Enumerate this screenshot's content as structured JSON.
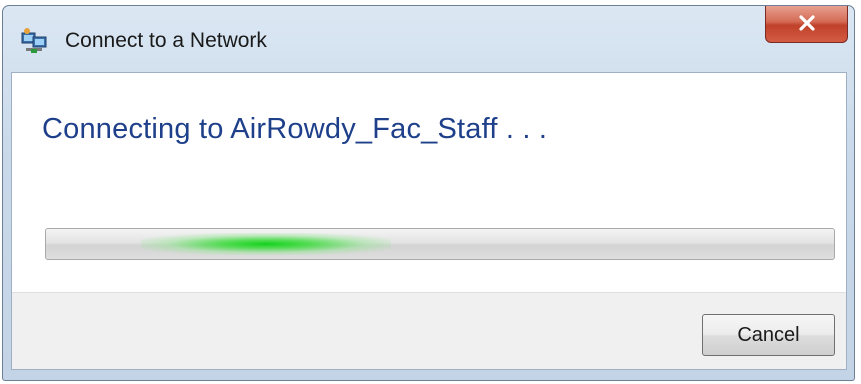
{
  "window": {
    "title": "Connect to a Network",
    "icon": "network-icon",
    "close_icon": "close-icon"
  },
  "main": {
    "heading": "Connecting to AirRowdy_Fac_Staff . . ."
  },
  "progress": {
    "state": "indeterminate",
    "color": "#22cc33"
  },
  "footer": {
    "cancel_label": "Cancel"
  },
  "colors": {
    "heading": "#1e3f8a",
    "close_button": "#c9452f",
    "title_bar": "#c9d9ea"
  }
}
